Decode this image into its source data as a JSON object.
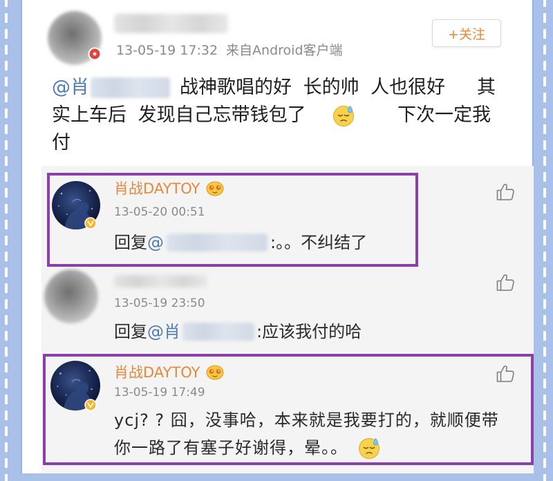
{
  "colors": {
    "frame_blue": "#a9c1e8",
    "highlight_purple": "#8b3fa9",
    "link_blue": "#4e7bb5",
    "author_orange": "#e3893c",
    "follow_orange": "#ef8532",
    "timestamp_gray": "#8a8a8a",
    "reply_bg": "#f4f4f4"
  },
  "icons": {
    "like": "thumbs-up-icon",
    "emoji": "sweat-emoji-icon",
    "verified": "verified-badge-icon",
    "member": "member-emoji-icon",
    "avatar_badge": "red-badge-icon"
  },
  "post": {
    "timestamp": "13-05-19 17:32",
    "source": "来自Android客户端",
    "follow_label": "+关注",
    "content": {
      "mention": "@肖",
      "line1_main": "战神歌唱的好 长的帅 人也很好",
      "line1_end": "其",
      "line2_main": "实上车后 发现自己忘带钱包了",
      "line2_end": "下次一定我",
      "line3": "付"
    }
  },
  "replies": [
    {
      "author": "肖战DAYTOY",
      "timestamp": "13-05-20 00:51",
      "prefix": "回复",
      "mention": "@",
      "text": ":。。不纠结了",
      "highlighted": true
    },
    {
      "timestamp": "13-05-19 23:50",
      "prefix": "回复",
      "mention": "@肖",
      "text": ":应该我付的哈",
      "highlighted": false
    },
    {
      "author": "肖战DAYTOY",
      "timestamp": "13-05-19 17:49",
      "text_line1": "ycj? ? 囧，没事哈，本来就是我要打的，就顺便带",
      "text_line2": "你一路了有塞子好谢得，晕。。",
      "highlighted": true
    }
  ]
}
